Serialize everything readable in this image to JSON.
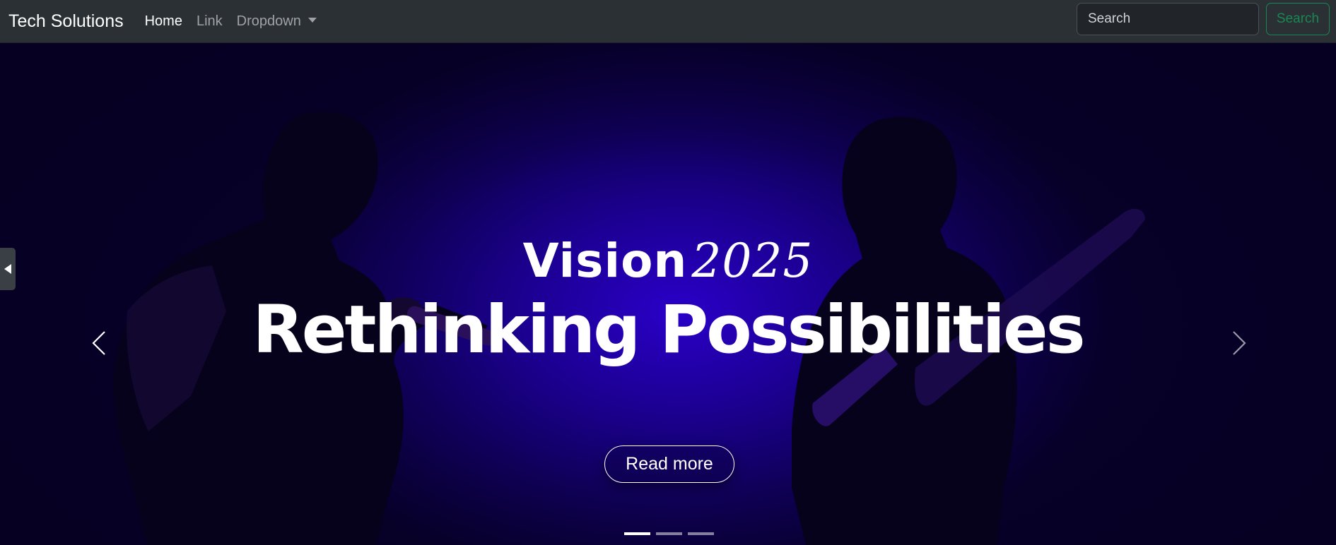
{
  "navbar": {
    "brand": "Tech Solutions",
    "links": [
      {
        "label": "Home",
        "active": true
      },
      {
        "label": "Link",
        "active": false
      },
      {
        "label": "Dropdown",
        "active": false
      }
    ],
    "search_placeholder": "Search",
    "search_button": "Search"
  },
  "hero": {
    "kicker_word": "Vision",
    "kicker_year": "2025",
    "headline": "Rethinking Possibilities",
    "button_label": "Read more",
    "slide_count": 3,
    "active_slide": 1
  },
  "icons": {
    "prev": "chevron-left-icon",
    "next": "chevron-right-icon",
    "side_tab": "triangle-left-icon"
  },
  "colors": {
    "navbar_bg": "#2b3035",
    "hero_accent": "#2a00c8",
    "search_button": "#198754"
  }
}
